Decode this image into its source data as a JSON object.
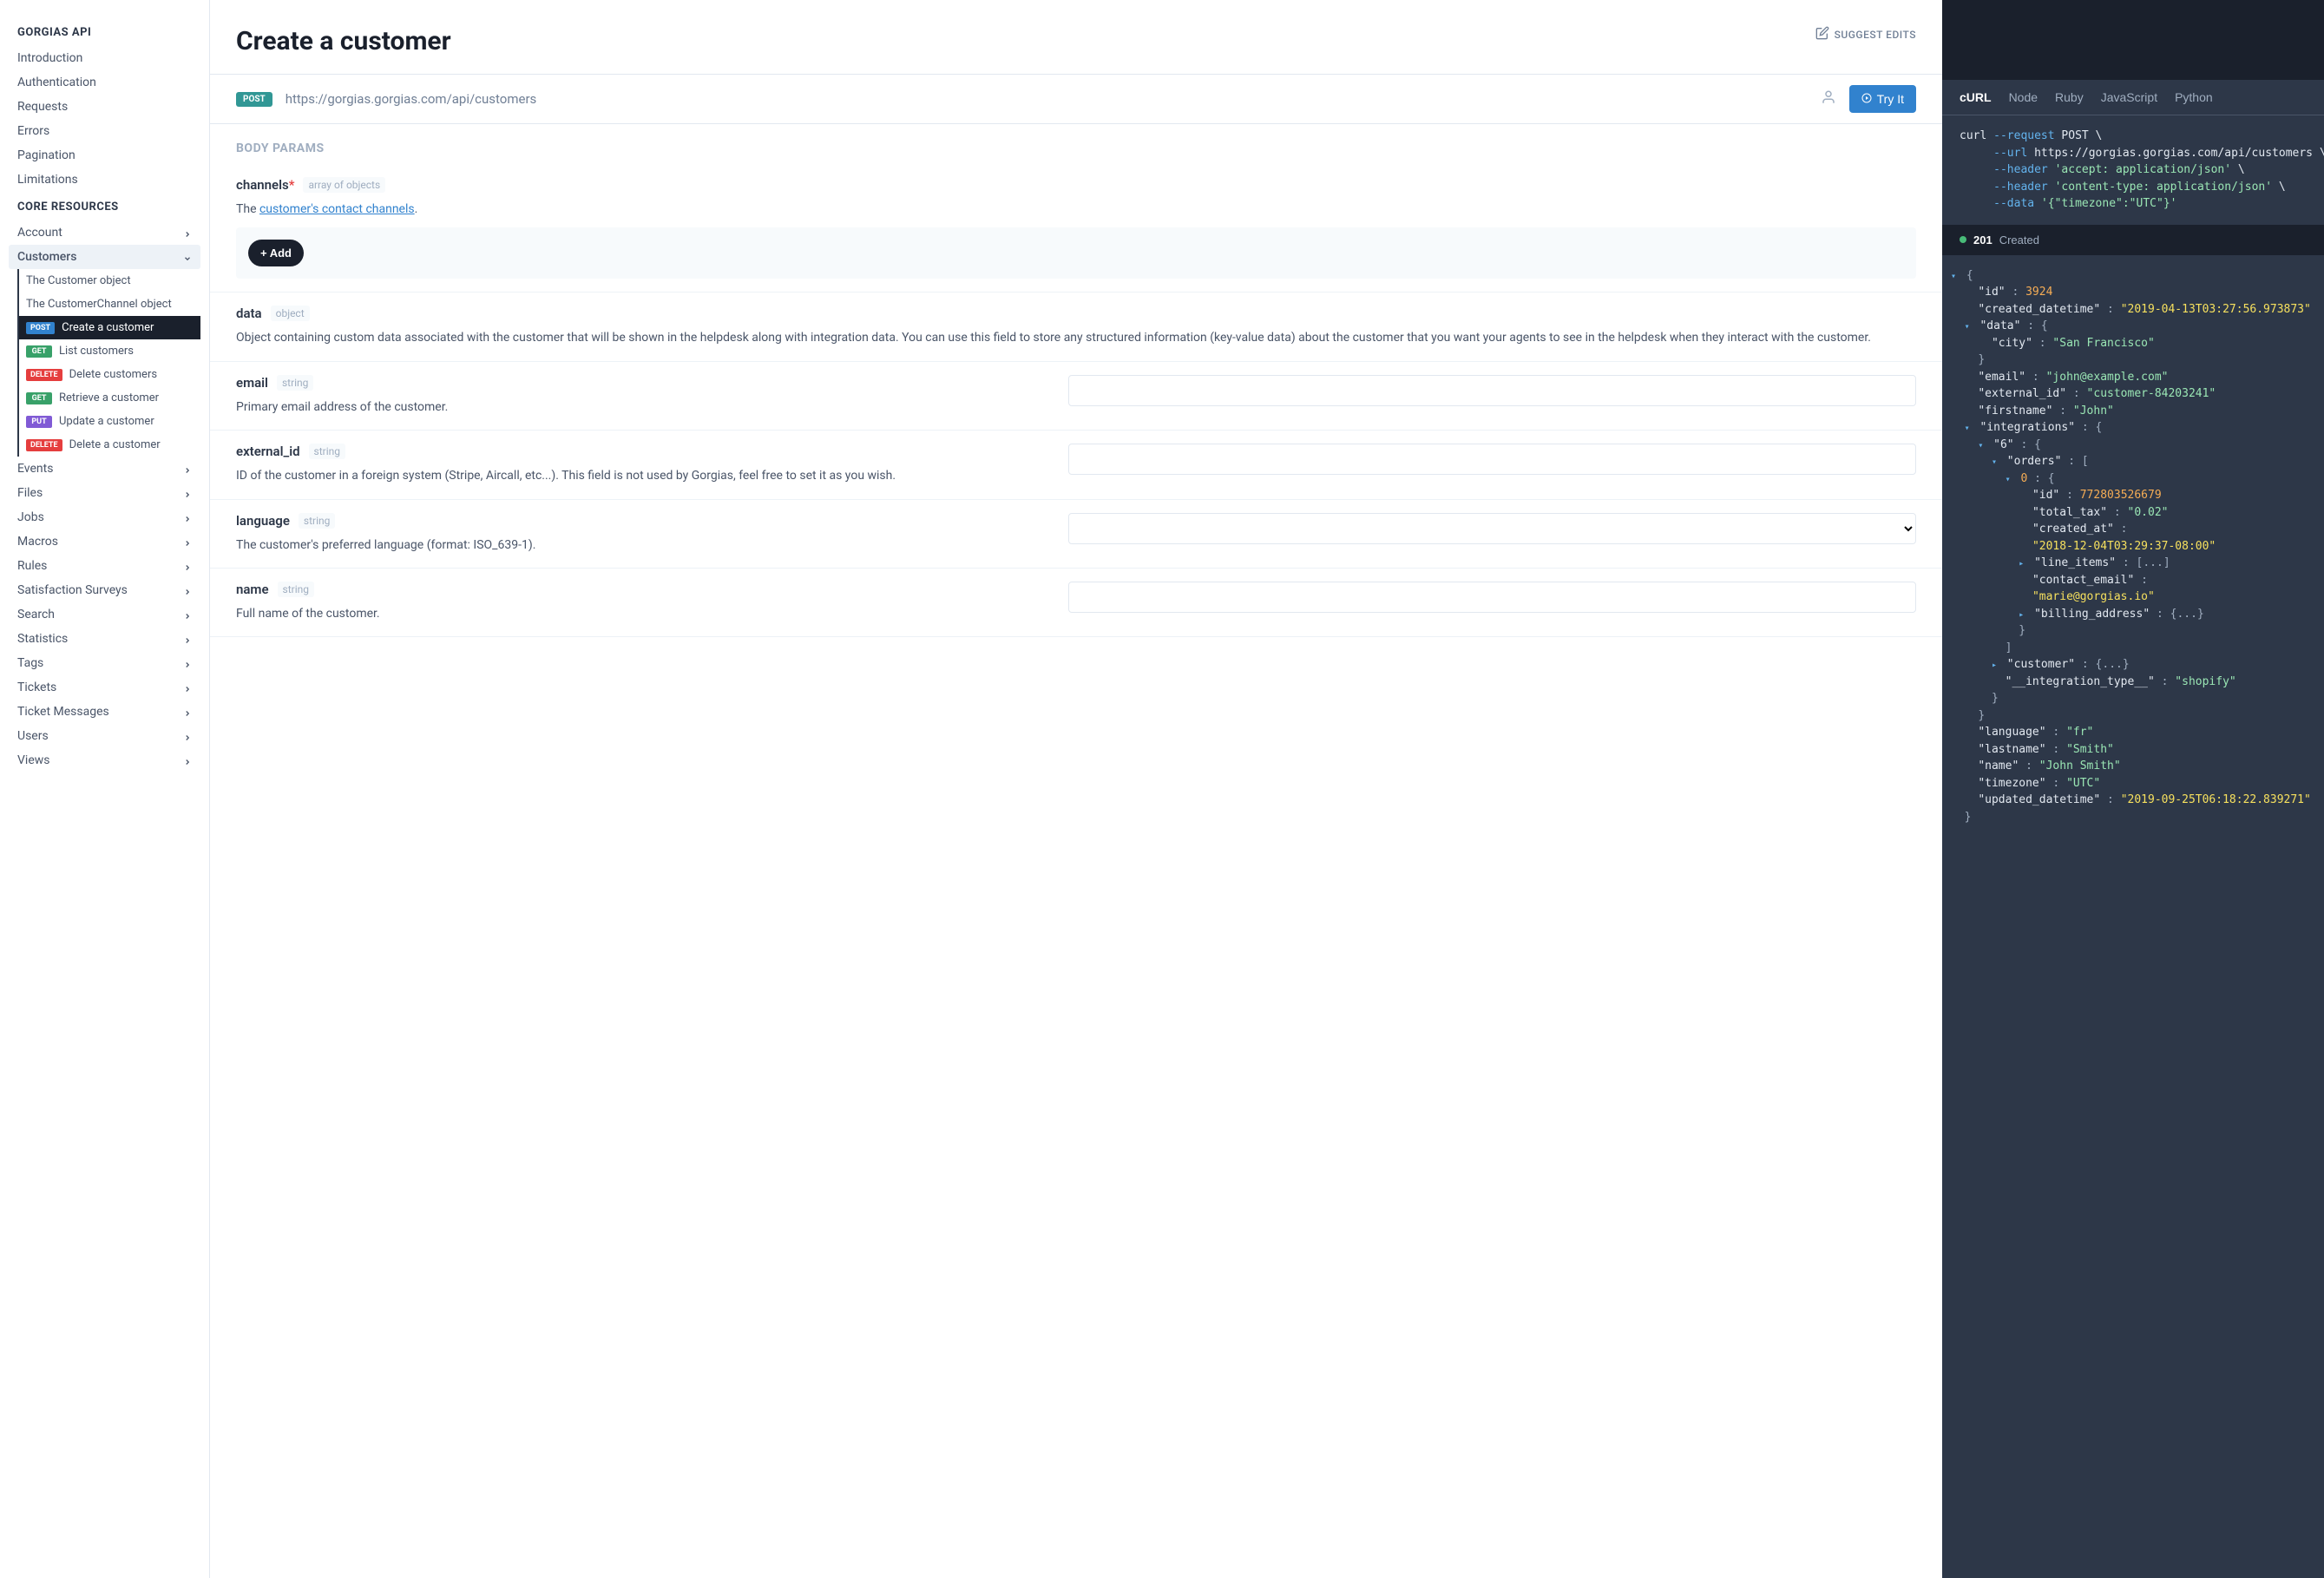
{
  "sidebar": {
    "section1_title": "GORGIAS API",
    "section1_items": [
      "Introduction",
      "Authentication",
      "Requests",
      "Errors",
      "Pagination",
      "Limitations"
    ],
    "section2_title": "CORE RESOURCES",
    "account_label": "Account",
    "customers_label": "Customers",
    "customers_children": [
      {
        "label": "The Customer object",
        "method": null
      },
      {
        "label": "The CustomerChannel object",
        "method": null
      },
      {
        "label": "Create a customer",
        "method": "POST",
        "active": true
      },
      {
        "label": "List customers",
        "method": "GET"
      },
      {
        "label": "Delete customers",
        "method": "DELETE"
      },
      {
        "label": "Retrieve a customer",
        "method": "GET"
      },
      {
        "label": "Update a customer",
        "method": "PUT"
      },
      {
        "label": "Delete a customer",
        "method": "DELETE"
      }
    ],
    "rest_items": [
      "Events",
      "Files",
      "Jobs",
      "Macros",
      "Rules",
      "Satisfaction Surveys",
      "Search",
      "Statistics",
      "Tags",
      "Tickets",
      "Ticket Messages",
      "Users",
      "Views"
    ]
  },
  "header": {
    "title": "Create a customer",
    "suggest_edits": "SUGGEST EDITS"
  },
  "endpoint": {
    "method": "POST",
    "url": "https://gorgias.gorgias.com/api/customers",
    "try_it": "Try It"
  },
  "body_params_title": "BODY PARAMS",
  "params": {
    "channels": {
      "name": "channels",
      "required": "*",
      "type": "array of objects",
      "desc_prefix": "The ",
      "desc_link": "customer's contact channels",
      "desc_suffix": ".",
      "add_label": "+ Add"
    },
    "data": {
      "name": "data",
      "type": "object",
      "desc": "Object containing custom data associated with the customer that will be shown in the helpdesk along with integration data. You can use this field to store any structured information (key-value data) about the customer that you want your agents to see in the helpdesk when they interact with the customer."
    },
    "email": {
      "name": "email",
      "type": "string",
      "desc": "Primary email address of the customer."
    },
    "external_id": {
      "name": "external_id",
      "type": "string",
      "desc": "ID of the customer in a foreign system (Stripe, Aircall, etc...). This field is not used by Gorgias, feel free to set it as you wish."
    },
    "language": {
      "name": "language",
      "type": "string",
      "desc": "The customer's preferred language (format: ISO_639-1)."
    },
    "name": {
      "name": "name",
      "type": "string",
      "desc": "Full name of the customer."
    }
  },
  "code": {
    "tabs": [
      "cURL",
      "Node",
      "Ruby",
      "JavaScript",
      "Python"
    ],
    "curl_lines": [
      {
        "segments": [
          {
            "t": "curl ",
            "c": "cmd"
          },
          {
            "t": "--request",
            "c": "opt"
          },
          {
            "t": " POST \\",
            "c": "cmd"
          }
        ]
      },
      {
        "segments": [
          {
            "t": "     ",
            "c": "cmd"
          },
          {
            "t": "--url",
            "c": "opt"
          },
          {
            "t": " https://gorgias.gorgias.com/api/customers \\",
            "c": "cmd"
          }
        ]
      },
      {
        "segments": [
          {
            "t": "     ",
            "c": "cmd"
          },
          {
            "t": "--header",
            "c": "opt"
          },
          {
            "t": " ",
            "c": "cmd"
          },
          {
            "t": "'accept: application/json'",
            "c": "strg"
          },
          {
            "t": " \\",
            "c": "cmd"
          }
        ]
      },
      {
        "segments": [
          {
            "t": "     ",
            "c": "cmd"
          },
          {
            "t": "--header",
            "c": "opt"
          },
          {
            "t": " ",
            "c": "cmd"
          },
          {
            "t": "'content-type: application/json'",
            "c": "strg"
          },
          {
            "t": " \\",
            "c": "cmd"
          }
        ]
      },
      {
        "segments": [
          {
            "t": "     ",
            "c": "cmd"
          },
          {
            "t": "--data",
            "c": "opt"
          },
          {
            "t": " ",
            "c": "cmd"
          },
          {
            "t": "'{\"timezone\":\"UTC\"}'",
            "c": "strg"
          }
        ]
      }
    ],
    "response": {
      "status": "201",
      "text": "Created"
    },
    "json": [
      {
        "indent": 0,
        "toggle": "▾",
        "content": [
          {
            "t": "{",
            "c": "punc"
          }
        ]
      },
      {
        "indent": 1,
        "content": [
          {
            "t": "\"id\"",
            "c": "key"
          },
          {
            "t": " : ",
            "c": "punc"
          },
          {
            "t": "3924",
            "c": "num"
          }
        ]
      },
      {
        "indent": 1,
        "content": [
          {
            "t": "\"created_datetime\"",
            "c": "key"
          },
          {
            "t": " : ",
            "c": "punc"
          },
          {
            "t": "\"2019-04-13T03:27:56.973873\"",
            "c": "strhl"
          }
        ]
      },
      {
        "indent": 1,
        "toggle": "▾",
        "content": [
          {
            "t": "\"data\"",
            "c": "key"
          },
          {
            "t": " : {",
            "c": "punc"
          }
        ]
      },
      {
        "indent": 2,
        "content": [
          {
            "t": "\"city\"",
            "c": "key"
          },
          {
            "t": " : ",
            "c": "punc"
          },
          {
            "t": "\"San Francisco\"",
            "c": "str"
          }
        ]
      },
      {
        "indent": 1,
        "content": [
          {
            "t": "}",
            "c": "punc"
          }
        ]
      },
      {
        "indent": 1,
        "content": [
          {
            "t": "\"email\"",
            "c": "key"
          },
          {
            "t": " : ",
            "c": "punc"
          },
          {
            "t": "\"john@example.com\"",
            "c": "str"
          }
        ]
      },
      {
        "indent": 1,
        "content": [
          {
            "t": "\"external_id\"",
            "c": "key"
          },
          {
            "t": " : ",
            "c": "punc"
          },
          {
            "t": "\"customer-84203241\"",
            "c": "str"
          }
        ]
      },
      {
        "indent": 1,
        "content": [
          {
            "t": "\"firstname\"",
            "c": "key"
          },
          {
            "t": " : ",
            "c": "punc"
          },
          {
            "t": "\"John\"",
            "c": "str"
          }
        ]
      },
      {
        "indent": 1,
        "toggle": "▾",
        "content": [
          {
            "t": "\"integrations\"",
            "c": "key"
          },
          {
            "t": " : {",
            "c": "punc"
          }
        ]
      },
      {
        "indent": 2,
        "toggle": "▾",
        "content": [
          {
            "t": "\"6\"",
            "c": "key"
          },
          {
            "t": " : {",
            "c": "punc"
          }
        ]
      },
      {
        "indent": 3,
        "toggle": "▾",
        "content": [
          {
            "t": "\"orders\"",
            "c": "key"
          },
          {
            "t": " : [",
            "c": "punc"
          }
        ]
      },
      {
        "indent": 4,
        "toggle": "▾",
        "content": [
          {
            "t": "0",
            "c": "num"
          },
          {
            "t": " : {",
            "c": "punc"
          }
        ]
      },
      {
        "indent": 5,
        "content": [
          {
            "t": "\"id\"",
            "c": "key"
          },
          {
            "t": " : ",
            "c": "punc"
          },
          {
            "t": "772803526679",
            "c": "num"
          }
        ]
      },
      {
        "indent": 5,
        "content": [
          {
            "t": "\"total_tax\"",
            "c": "key"
          },
          {
            "t": " : ",
            "c": "punc"
          },
          {
            "t": "\"0.02\"",
            "c": "str"
          }
        ]
      },
      {
        "indent": 5,
        "content": [
          {
            "t": "\"created_at\"",
            "c": "key"
          },
          {
            "t": " : ",
            "c": "punc"
          }
        ]
      },
      {
        "indent": 5,
        "content": [
          {
            "t": "\"2018-12-04T03:29:37-08:00\"",
            "c": "strhl"
          }
        ]
      },
      {
        "indent": 5,
        "toggle": "▸",
        "content": [
          {
            "t": "\"line_items\"",
            "c": "key"
          },
          {
            "t": " : [...]",
            "c": "punc"
          }
        ]
      },
      {
        "indent": 5,
        "content": [
          {
            "t": "\"contact_email\"",
            "c": "key"
          },
          {
            "t": " : ",
            "c": "punc"
          }
        ]
      },
      {
        "indent": 5,
        "content": [
          {
            "t": "\"marie@gorgias.io\"",
            "c": "strhl"
          }
        ]
      },
      {
        "indent": 5,
        "toggle": "▸",
        "content": [
          {
            "t": "\"billing_address\"",
            "c": "key"
          },
          {
            "t": " : {...}",
            "c": "punc"
          }
        ]
      },
      {
        "indent": 4,
        "content": [
          {
            "t": "}",
            "c": "punc"
          }
        ]
      },
      {
        "indent": 3,
        "content": [
          {
            "t": "]",
            "c": "punc"
          }
        ]
      },
      {
        "indent": 3,
        "toggle": "▸",
        "content": [
          {
            "t": "\"customer\"",
            "c": "key"
          },
          {
            "t": " : {...}",
            "c": "punc"
          }
        ]
      },
      {
        "indent": 3,
        "content": [
          {
            "t": "\"__integration_type__\"",
            "c": "key"
          },
          {
            "t": " : ",
            "c": "punc"
          },
          {
            "t": "\"shopify\"",
            "c": "str"
          }
        ]
      },
      {
        "indent": 2,
        "content": [
          {
            "t": "}",
            "c": "punc"
          }
        ]
      },
      {
        "indent": 1,
        "content": [
          {
            "t": "}",
            "c": "punc"
          }
        ]
      },
      {
        "indent": 1,
        "content": [
          {
            "t": "\"language\"",
            "c": "key"
          },
          {
            "t": " : ",
            "c": "punc"
          },
          {
            "t": "\"fr\"",
            "c": "str"
          }
        ]
      },
      {
        "indent": 1,
        "content": [
          {
            "t": "\"lastname\"",
            "c": "key"
          },
          {
            "t": " : ",
            "c": "punc"
          },
          {
            "t": "\"Smith\"",
            "c": "str"
          }
        ]
      },
      {
        "indent": 1,
        "content": [
          {
            "t": "\"name\"",
            "c": "key"
          },
          {
            "t": " : ",
            "c": "punc"
          },
          {
            "t": "\"John Smith\"",
            "c": "str"
          }
        ]
      },
      {
        "indent": 1,
        "content": [
          {
            "t": "\"timezone\"",
            "c": "key"
          },
          {
            "t": " : ",
            "c": "punc"
          },
          {
            "t": "\"UTC\"",
            "c": "str"
          }
        ]
      },
      {
        "indent": 1,
        "content": [
          {
            "t": "\"updated_datetime\"",
            "c": "key"
          },
          {
            "t": " : ",
            "c": "punc"
          },
          {
            "t": "\"2019-09-25T06:18:22.839271\"",
            "c": "strhl"
          }
        ]
      },
      {
        "indent": 0,
        "content": [
          {
            "t": "}",
            "c": "punc"
          }
        ]
      }
    ]
  }
}
